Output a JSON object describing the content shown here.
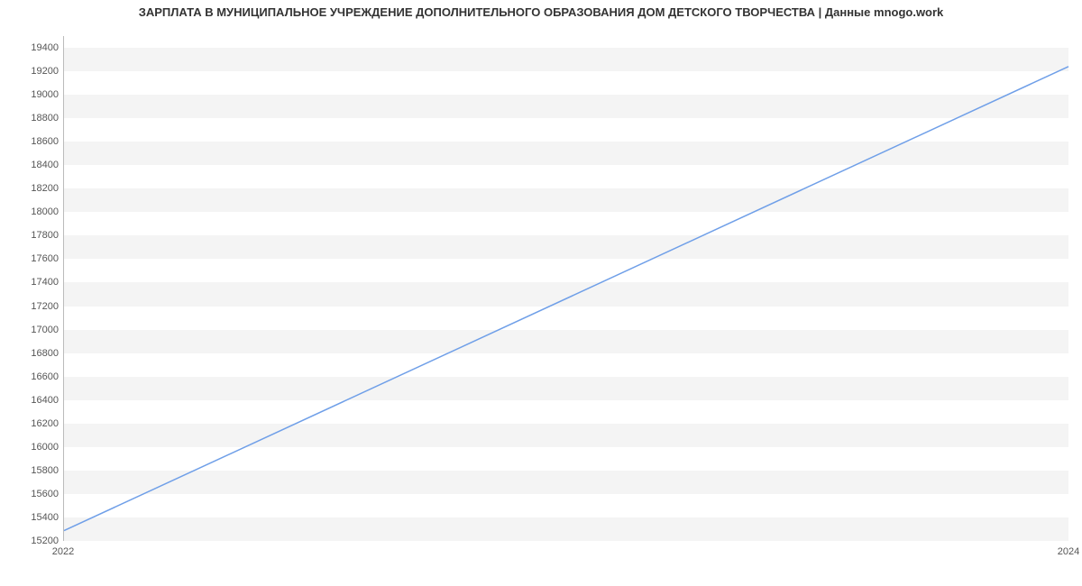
{
  "chart_data": {
    "type": "line",
    "title": "ЗАРПЛАТА В МУНИЦИПАЛЬНОЕ УЧРЕЖДЕНИЕ ДОПОЛНИТЕЛЬНОГО ОБРАЗОВАНИЯ ДОМ ДЕТСКОГО ТВОРЧЕСТВА | Данные mnogo.work",
    "xlabel": "",
    "ylabel": "",
    "x": [
      2022,
      2024
    ],
    "values": [
      15280,
      19240
    ],
    "x_ticks": [
      2022,
      2024
    ],
    "y_ticks": [
      15200,
      15400,
      15600,
      15800,
      16000,
      16200,
      16400,
      16600,
      16800,
      17000,
      17200,
      17400,
      17600,
      17800,
      18000,
      18200,
      18400,
      18600,
      18800,
      19000,
      19200,
      19400
    ],
    "xlim": [
      2022,
      2024
    ],
    "ylim": [
      15200,
      19500
    ],
    "line_color": "#6f9fe8"
  }
}
